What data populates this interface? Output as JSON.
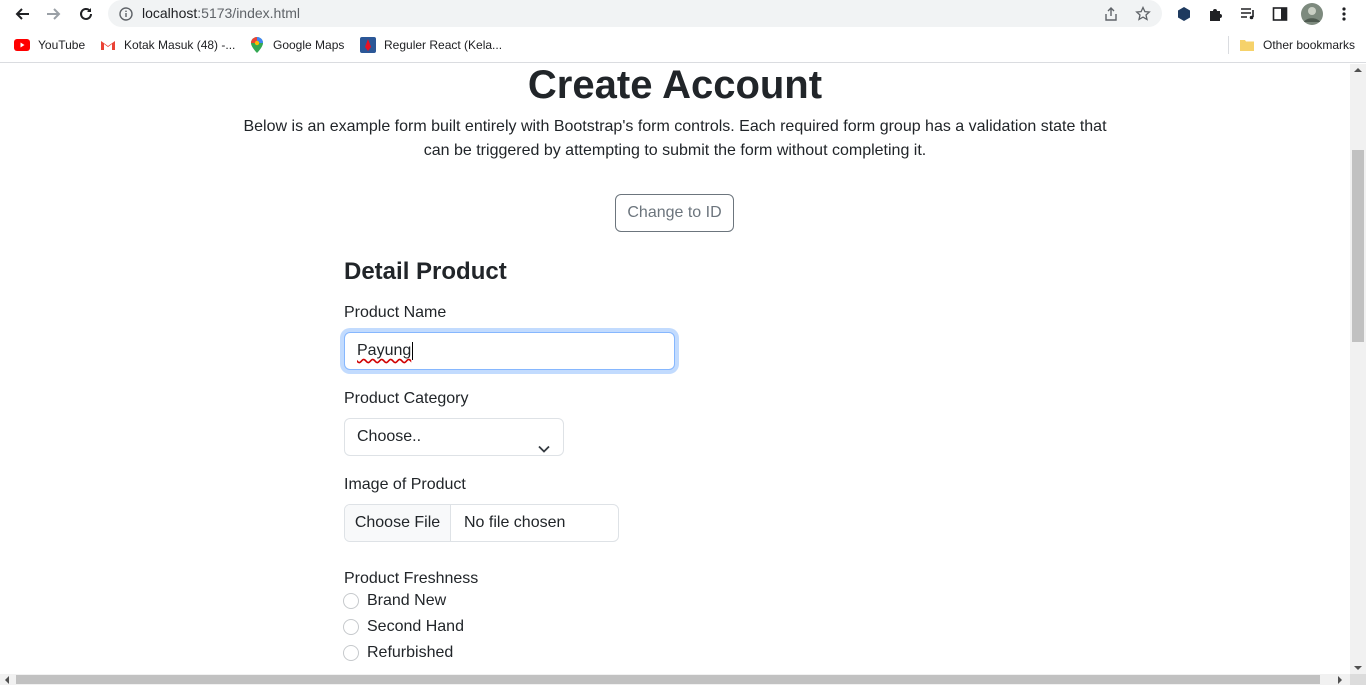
{
  "browser": {
    "url_host": "localhost",
    "url_path": ":5173/index.html",
    "bookmarks": [
      {
        "label": "YouTube",
        "icon": "youtube-icon"
      },
      {
        "label": "Kotak Masuk (48) -...",
        "icon": "gmail-icon"
      },
      {
        "label": "Google Maps",
        "icon": "maps-icon"
      },
      {
        "label": "Reguler React (Kela...",
        "icon": "bookmark-site-icon"
      }
    ],
    "other_bookmarks": "Other bookmarks"
  },
  "page": {
    "title": "Create Account",
    "lead": "Below is an example form built entirely with Bootstrap's form controls. Each required form group has a validation state that can be triggered by attempting to submit the form without completing it.",
    "language_button": "Change to ID"
  },
  "form": {
    "section_title": "Detail Product",
    "product_name_label": "Product Name",
    "product_name_value": "Payung",
    "category_label": "Product Category",
    "category_selected": "Choose..",
    "image_label": "Image of Product",
    "file_button": "Choose File",
    "file_status": "No file chosen",
    "freshness_label": "Product Freshness",
    "freshness_options": [
      "Brand New",
      "Second Hand",
      "Refurbished"
    ]
  },
  "colors": {
    "accent_focus": "#86b7fe",
    "outline_secondary": "#6c757d",
    "text": "#212529"
  }
}
